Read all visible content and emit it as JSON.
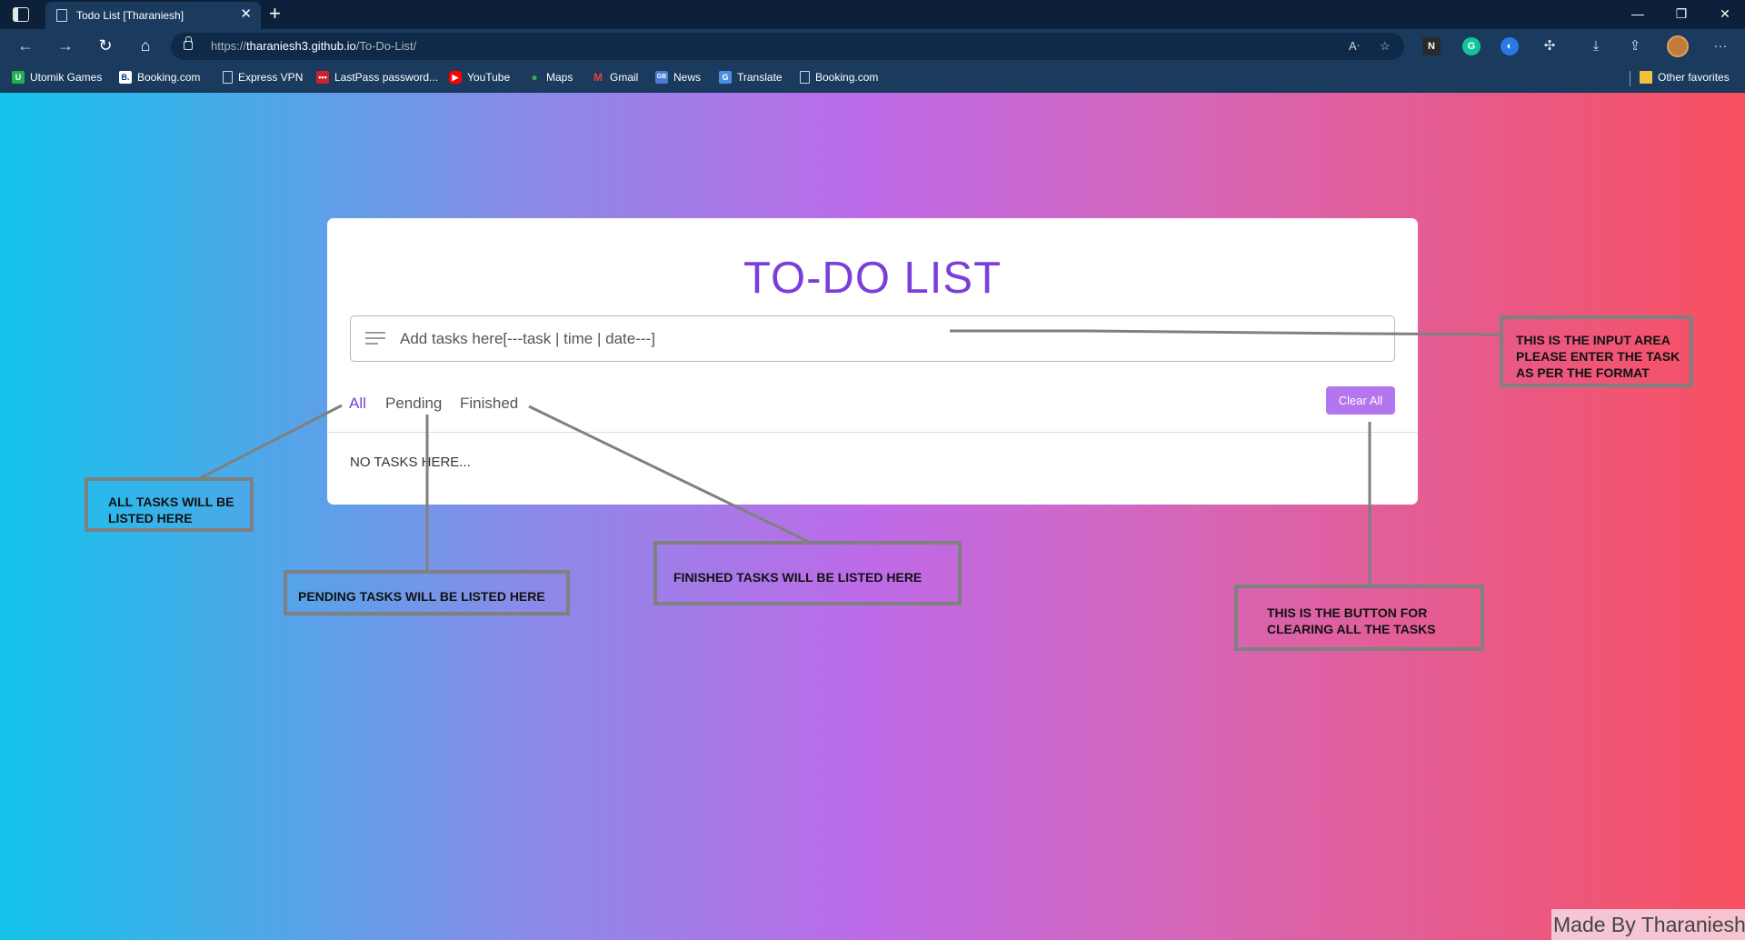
{
  "browser": {
    "tab_title": "Todo List [Tharaniesh]",
    "tab_close": "✕",
    "new_tab": "+",
    "url_scheme": "https://",
    "url_host": "tharaniesh3.github.io",
    "url_path": "/To-Do-List/",
    "window_controls": {
      "minimize": "—",
      "restore": "❐",
      "close": "✕"
    },
    "favorites": [
      {
        "label": "Utomik Games",
        "icon": "utomik-icon",
        "color": "#22b24c",
        "glyph": "U"
      },
      {
        "label": "Booking.com",
        "icon": "booking-icon",
        "color": "#ffffff",
        "glyph": "B."
      },
      {
        "label": "Express VPN",
        "icon": "page-icon",
        "color": "",
        "glyph": ""
      },
      {
        "label": "LastPass password...",
        "icon": "lastpass-icon",
        "color": "#cc2229",
        "glyph": "•••"
      },
      {
        "label": "YouTube",
        "icon": "youtube-icon",
        "color": "#ff0000",
        "glyph": "▶"
      },
      {
        "label": "Maps",
        "icon": "maps-icon",
        "color": "#34a853",
        "glyph": "●"
      },
      {
        "label": "Gmail",
        "icon": "gmail-icon",
        "color": "#ea4335",
        "glyph": "M"
      },
      {
        "label": "News",
        "icon": "news-icon",
        "color": "#4a7bd0",
        "glyph": "GB"
      },
      {
        "label": "Translate",
        "icon": "translate-icon",
        "color": "#4a90e2",
        "glyph": "G"
      },
      {
        "label": "Booking.com",
        "icon": "page-icon",
        "color": "",
        "glyph": ""
      }
    ],
    "other_favorites": "Other favorites"
  },
  "app": {
    "title": "TO-DO LIST",
    "input_placeholder": "Add tasks here[---task  |  time  |  date---]",
    "filters": [
      "All",
      "Pending",
      "Finished"
    ],
    "active_filter": "All",
    "clear_button": "Clear All",
    "empty_message": "NO TASKS HERE..."
  },
  "annotations": {
    "input_area": [
      "THIS IS THE INPUT AREA",
      "PLEASE ENTER THE TASK",
      "AS PER THE FORMAT"
    ],
    "all_tasks": [
      "ALL TASKS WILL BE",
      "LISTED HERE"
    ],
    "pending_tasks": [
      "PENDING TASKS WILL BE LISTED HERE"
    ],
    "finished_tasks": [
      "FINISHED TASKS WILL BE LISTED HERE"
    ],
    "clear_button": [
      "THIS IS THE BUTTON FOR",
      "CLEARING ALL THE TASKS"
    ]
  },
  "watermark": "Made By Tharaniesh",
  "colors": {
    "accent": "#7a3fd9",
    "clear_button_bg": "#b476ee",
    "gradient_left": "#13c3ea",
    "gradient_mid": "#be6ae8",
    "gradient_right": "#f85060",
    "annotation_border": "#808080"
  }
}
